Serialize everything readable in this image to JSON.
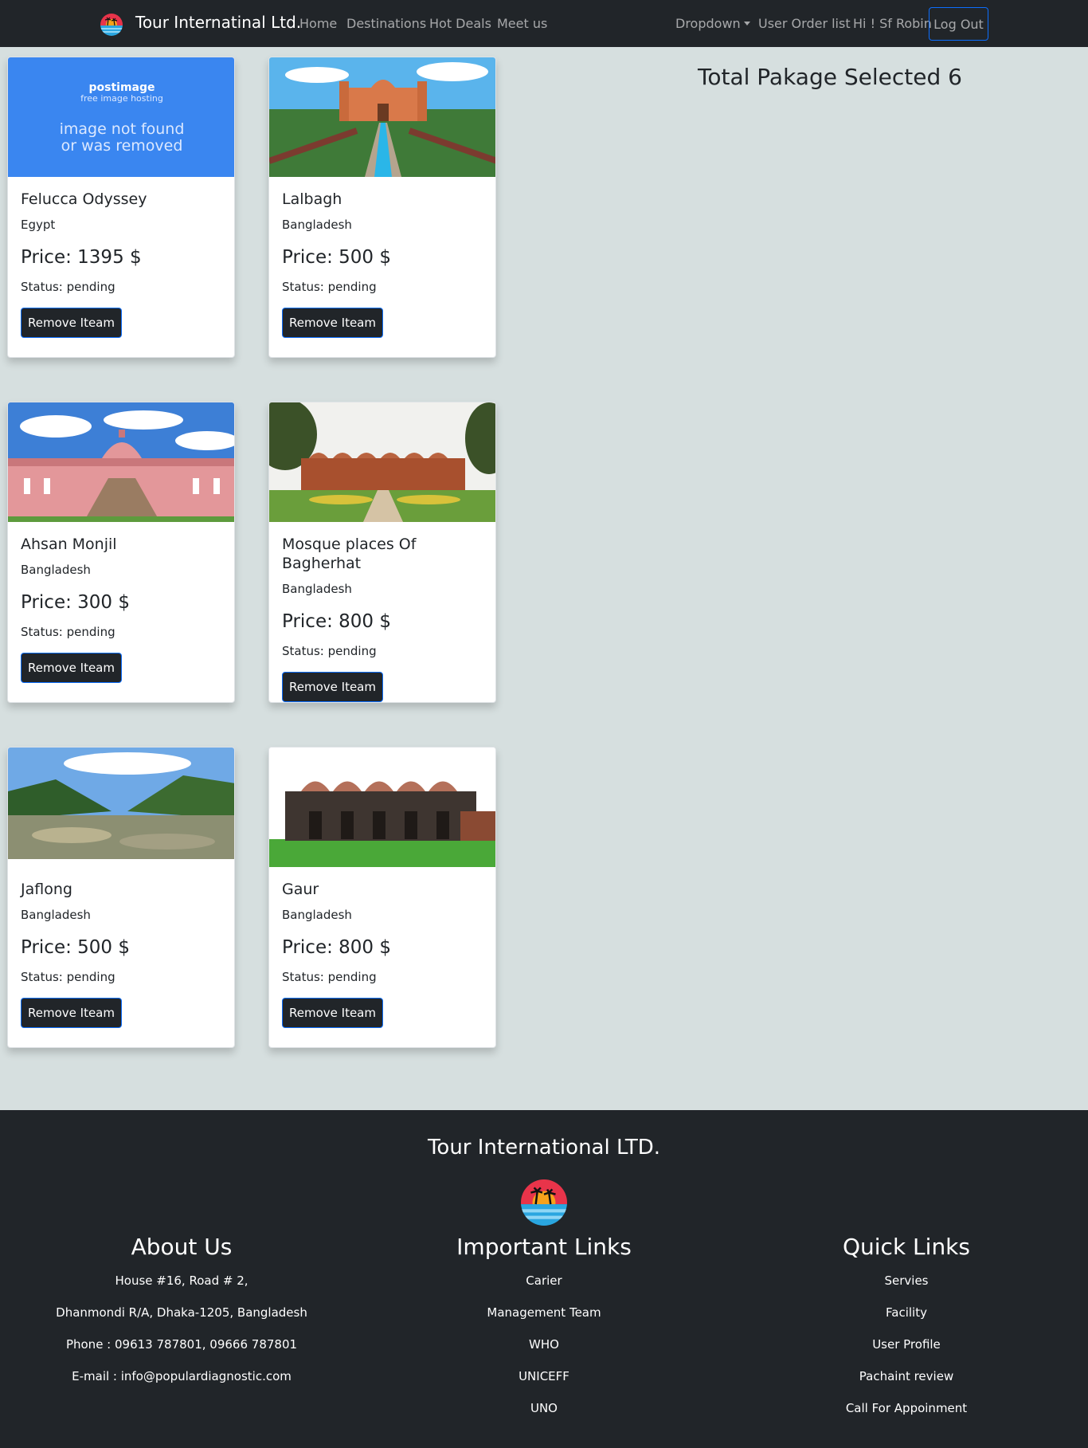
{
  "navbar": {
    "brand": "Tour Internatinal Ltd.",
    "links": [
      "Home",
      "Destinations",
      "Hot Deals",
      "Meet us"
    ],
    "dropdown": "Dropdown",
    "order_list": "User Order list",
    "greeting": "Hi ! Sf Robin",
    "logout": "Log Out"
  },
  "summary": {
    "total_text": "Total Pakage Selected 6"
  },
  "broken_image": {
    "line1": "postimage",
    "line2": "free image hosting",
    "line3": "image not found",
    "line4": "or was removed"
  },
  "cards": [
    {
      "title": "Felucca Odyssey",
      "country": "Egypt",
      "price": "Price: 1395 $",
      "status": "Status: pending",
      "button": "Remove Iteam"
    },
    {
      "title": "Lalbagh",
      "country": "Bangladesh",
      "price": "Price: 500 $",
      "status": "Status: pending",
      "button": "Remove Iteam"
    },
    {
      "title": "Ahsan Monjil",
      "country": "Bangladesh",
      "price": "Price: 300 $",
      "status": "Status: pending",
      "button": "Remove Iteam"
    },
    {
      "title_line1": "Mosque places Of",
      "title_line2": "Bagherhat",
      "country": "Bangladesh",
      "price": "Price: 800 $",
      "status": "Status: pending",
      "button": "Remove Iteam"
    },
    {
      "title": "Jaflong",
      "country": "Bangladesh",
      "price": "Price: 500 $",
      "status": "Status: pending",
      "button": "Remove Iteam"
    },
    {
      "title": "Gaur",
      "country": "Bangladesh",
      "price": "Price: 800 $",
      "status": "Status: pending",
      "button": "Remove Iteam"
    }
  ],
  "footer": {
    "title": "Tour International LTD.",
    "about": {
      "heading": "About Us",
      "lines": [
        "House #16, Road # 2,",
        "Dhanmondi R/A, Dhaka-1205, Bangladesh",
        "Phone : 09613 787801, 09666 787801",
        "E-mail : info@populardiagnostic.com"
      ]
    },
    "important": {
      "heading": "Important Links",
      "links": [
        "Carier",
        "Management Team",
        "WHO",
        "UNICEFF",
        "UNO"
      ]
    },
    "quick": {
      "heading": "Quick Links",
      "links": [
        "Servies",
        "Facility",
        "User Profile",
        "Pachaint review",
        "Call For Appoinment"
      ]
    }
  },
  "colors": {
    "navbar_bg": "#212529",
    "page_bg": "#d6dfdf",
    "button_border": "#0d6efd"
  },
  "icons": {
    "brand": "sunset-palm-logo-icon",
    "footer": "sunset-palm-logo-icon"
  }
}
